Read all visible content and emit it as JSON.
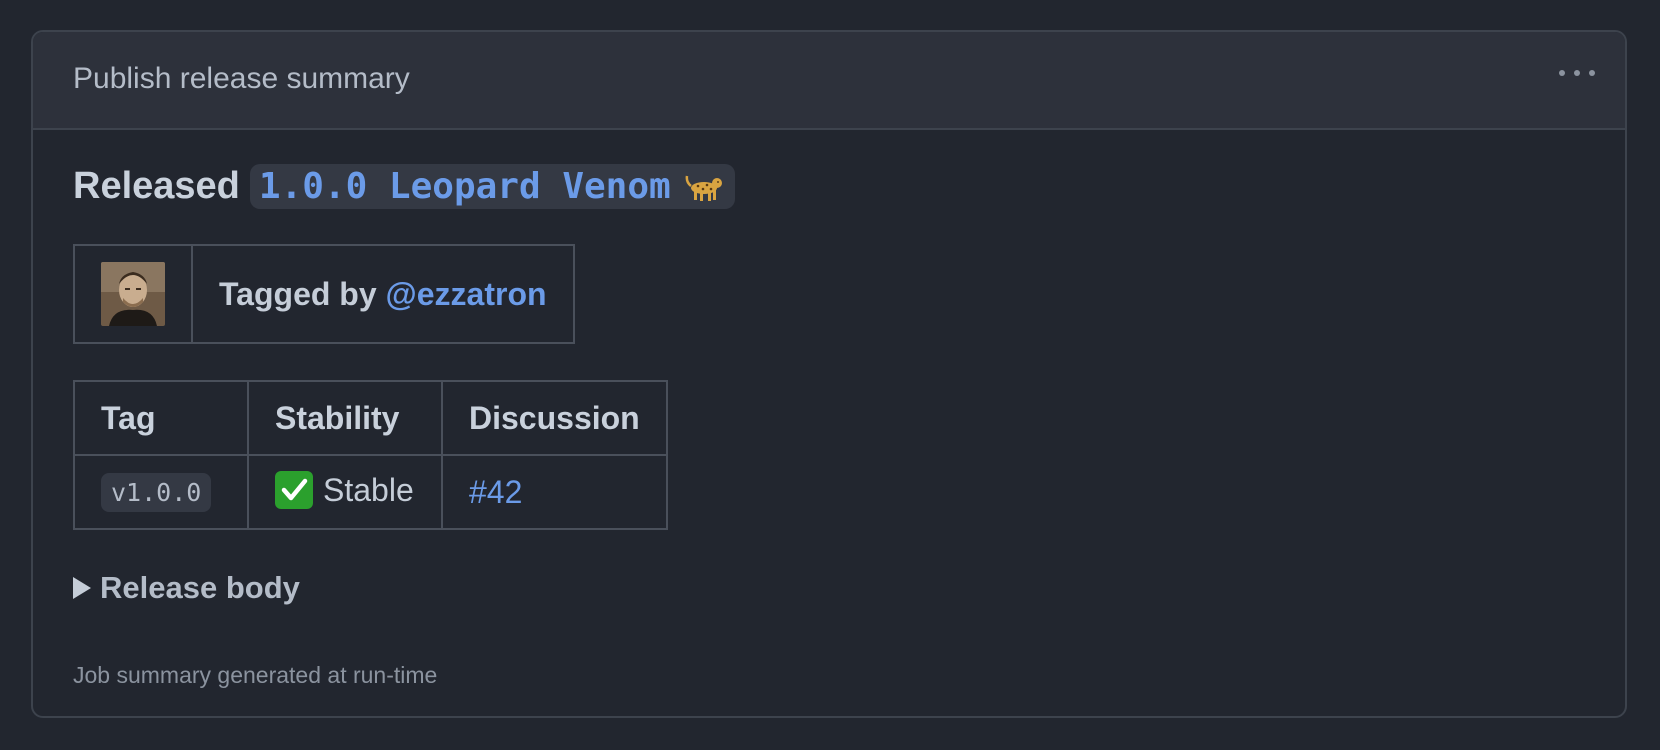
{
  "card": {
    "title": "Publish release summary",
    "menu_icon": "kebab-menu-icon"
  },
  "headline": {
    "prefix": "Released",
    "release_name": "1.0.0 Leopard Venom",
    "emoji_icon": "leopard-icon"
  },
  "tagger": {
    "avatar_icon": "avatar",
    "prefix": "Tagged by",
    "username": "@ezzatron"
  },
  "info_table": {
    "headers": [
      "Tag",
      "Stability",
      "Discussion"
    ],
    "row": {
      "tag": "v1.0.0",
      "stability_icon": "check-mark-icon",
      "stability": "Stable",
      "discussion": "#42"
    }
  },
  "details": {
    "label": "Release body",
    "expanded": false
  },
  "footer": {
    "note": "Job summary generated at run-time"
  },
  "colors": {
    "background": "#22262f",
    "header_background": "#2d313b",
    "link": "#6b9be8",
    "border": "#3d434d",
    "check": "#2ba02d"
  }
}
